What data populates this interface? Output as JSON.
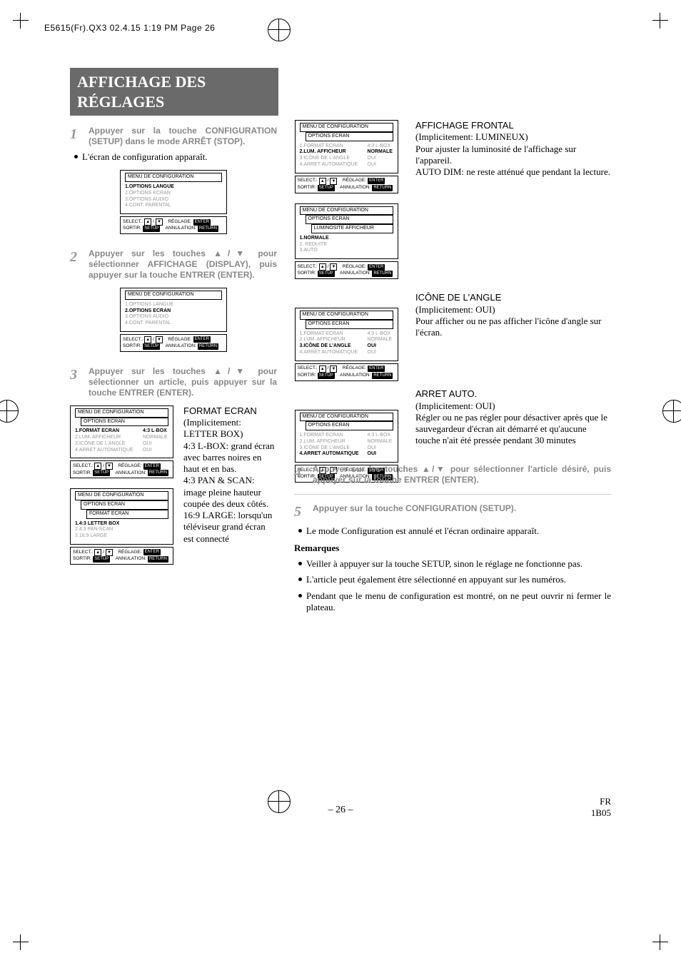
{
  "slug": "E5615(Fr).QX3  02.4.15 1:19 PM  Page 26",
  "title": "AFFICHAGE DES RÉGLAGES",
  "steps": {
    "s1": {
      "num": "1",
      "text": "Appuyer sur la touche CONFIGURATION (SETUP) dans le mode ARRÊT (STOP)."
    },
    "s1b": "L'écran de configuration apparaît.",
    "s2": {
      "num": "2",
      "text": "Appuyer sur les touches ▲/▼ pour sélectionner AFFICHAGE (DISPLAY), puis appuyer sur la touche ENTRER (ENTER)."
    },
    "s3": {
      "num": "3",
      "text": "Appuyer sur les touches ▲/▼ pour sélectionner un article, puis appuyer sur la touche ENTRER (ENTER)."
    },
    "s4": {
      "num": "4",
      "text": "Appuyer sur les touches ▲/▼ pour sélectionner l'article désiré, puis appuyer sur la touche ENTRER (ENTER)."
    },
    "s5": {
      "num": "5",
      "text": "Appuyer sur la touche CONFIGURATION (SETUP)."
    },
    "s5b": "Le mode Configuration est annulé et l'écran ordinaire apparaît."
  },
  "menus": {
    "m1": {
      "title": "MENU DE CONFIGURATION",
      "lines": [
        "1.OPTIONS LANGUE",
        "2.OPTIONS ECRAN",
        "3.OPTIONS AUDIO",
        "4.CONT. PARENTAL"
      ],
      "bold": 0
    },
    "m2": {
      "title": "MENU DE CONFIGURATION",
      "lines": [
        "1.OPTIONS LANGUE",
        "2.OPTIONS ECRAN",
        "3.OPTIONS AUDIO",
        "4.CONT. PARENTAL"
      ],
      "bold": 1
    },
    "opt1": {
      "title": "MENU DE CONFIGURATION",
      "sub": "OPTIONS ECRAN",
      "rows": [
        {
          "l": "1.FORMAT ECRAN",
          "r": "4:3 L-BOX",
          "b": true
        },
        {
          "l": "2.LUM. AFFICHEUR",
          "r": "NORMALE"
        },
        {
          "l": "3.ICÔNE DE L'ANGLE",
          "r": "OUI"
        },
        {
          "l": "4.ARRET AUTOMATIQUE",
          "r": "OUI"
        }
      ]
    },
    "fmt": {
      "title": "MENU DE CONFIGURATION",
      "sub": "OPTIONS ECRAN",
      "sub2": "FORMAT ECRAN",
      "lines": [
        "1.4:3 LETTER BOX",
        "2.4:3 PAN-SCAN",
        "3.16:9 LARGE"
      ],
      "bold": 0
    },
    "opt2": {
      "title": "MENU DE CONFIGURATION",
      "sub": "OPTIONS ECRAN",
      "rows": [
        {
          "l": "1.FORMAT ECRAN",
          "r": "4:3 L-BOX"
        },
        {
          "l": "2.LUM. AFFICHEUR",
          "r": "NORMALE",
          "b": true
        },
        {
          "l": "3.ICÔNE DE L'ANGLE",
          "r": "OUI"
        },
        {
          "l": "4.ARRET AUTOMATIQUE",
          "r": "OUI"
        }
      ]
    },
    "lum": {
      "title": "MENU DE CONFIGURATION",
      "sub": "OPTIONS ECRAN",
      "sub2": "LUMINOSITE AFFICHEUR",
      "lines": [
        "1.NORMALE",
        "2. REDUITE",
        "3.AUTO"
      ],
      "bold": 0
    },
    "opt3": {
      "title": "MENU DE CONFIGURATION",
      "sub": "OPTIONS ECRAN",
      "rows": [
        {
          "l": "1.FORMAT ECRAN",
          "r": "4:3 L-BOX"
        },
        {
          "l": "2.LUM. AFFICHEUR",
          "r": "NORMALE"
        },
        {
          "l": "3.ICÔNE DE L'ANGLE",
          "r": "OUI",
          "b": true
        },
        {
          "l": "4.ARRET AUTOMATIQUE",
          "r": "OUI"
        }
      ]
    },
    "opt4": {
      "title": "MENU DE CONFIGURATION",
      "sub": "OPTIONS ECRAN",
      "rows": [
        {
          "l": "1.FORMAT ECRAN",
          "r": "4:3 L-BOX"
        },
        {
          "l": "2.LUM. AFFICHEUR",
          "r": "NORMALE"
        },
        {
          "l": "3.ICÔNE DE L'ANGLE",
          "r": "OUI"
        },
        {
          "l": "4.ARRET AUTOMATIQUE",
          "r": "OUI",
          "b": true
        }
      ]
    },
    "footer": {
      "select": "SELECT.:",
      "reglage": "RÉGLAGE:",
      "enter": "ENTER",
      "sortir": "SORTIR:",
      "setup": "SETUP",
      "annul": "ANNULATION:",
      "return": "RETURN"
    }
  },
  "format_ecran": {
    "title": "FORMAT ECRAN",
    "sub": "(Implicitement: LETTER BOX)",
    "p1": "4:3 L-BOX: grand écran avec barres noires en haut et en bas.",
    "p2": "4:3 PAN & SCAN: image pleine hauteur coupée des deux côtés.",
    "p3": "16:9 LARGE: lorsqu'un téléviseur grand écran est connecté"
  },
  "affichage_frontal": {
    "title": "AFFICHAGE FRONTAL",
    "sub": "(Implicitement: LUMINEUX)",
    "p1": "Pour ajuster la luminosité de l'affichage sur l'appareil.",
    "p2": "AUTO DIM: ne reste atténué que pendant la lecture."
  },
  "icone_angle": {
    "title": "ICÔNE DE L'ANGLE",
    "sub": " (Implicitement: OUI)",
    "p1": "Pour afficher ou ne pas afficher l'icône d'angle sur l'écran."
  },
  "arret_auto": {
    "title": "ARRET AUTO.",
    "sub": "(Implicitement: OUI)",
    "p1": "Régler ou ne pas régler pour désactiver après que le sauvegardeur d'écran ait démarré et qu'aucune touche n'ait été pressée pendant 30 minutes"
  },
  "remarques": {
    "title": "Remarques",
    "r1": "Veiller à appuyer sur la touche SETUP, sinon le réglage ne fonctionne pas.",
    "r2": "L'article peut également être sélectionné en appuyant sur les numéros.",
    "r3": "Pendant que le menu de configuration est montré, on ne peut ouvrir ni fermer le plateau."
  },
  "pagenum": "– 26 –",
  "fr_label": "FR",
  "fr_code": "1B05"
}
